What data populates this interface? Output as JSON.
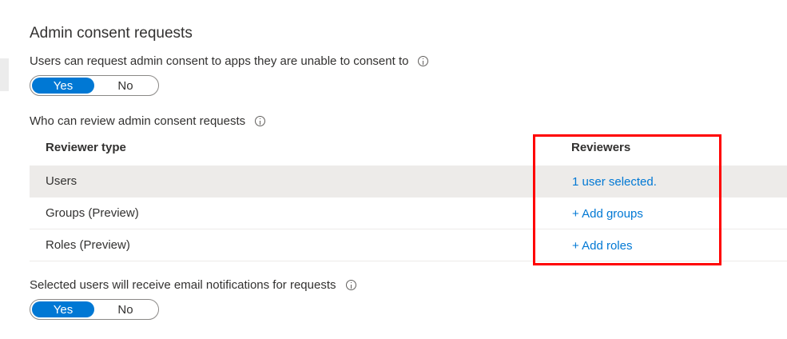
{
  "section": {
    "title": "Admin consent requests"
  },
  "consent_toggle": {
    "label": "Users can request admin consent to apps they are unable to consent to",
    "yes": "Yes",
    "no": "No",
    "selected": "Yes"
  },
  "reviewers": {
    "label": "Who can review admin consent requests",
    "columns": [
      "Reviewer type",
      "Reviewers"
    ],
    "rows": [
      {
        "type": "Users",
        "reviewers": "1 user selected."
      },
      {
        "type": "Groups (Preview)",
        "reviewers": "+ Add groups"
      },
      {
        "type": "Roles (Preview)",
        "reviewers": "+ Add roles"
      }
    ]
  },
  "notify_toggle": {
    "label": "Selected users will receive email notifications for requests",
    "yes": "Yes",
    "no": "No",
    "selected": "Yes"
  },
  "colors": {
    "accent": "#0078d4",
    "highlight": "#ff0000",
    "selected_row": "#edebe9"
  },
  "icons": {
    "info": "info-icon"
  }
}
